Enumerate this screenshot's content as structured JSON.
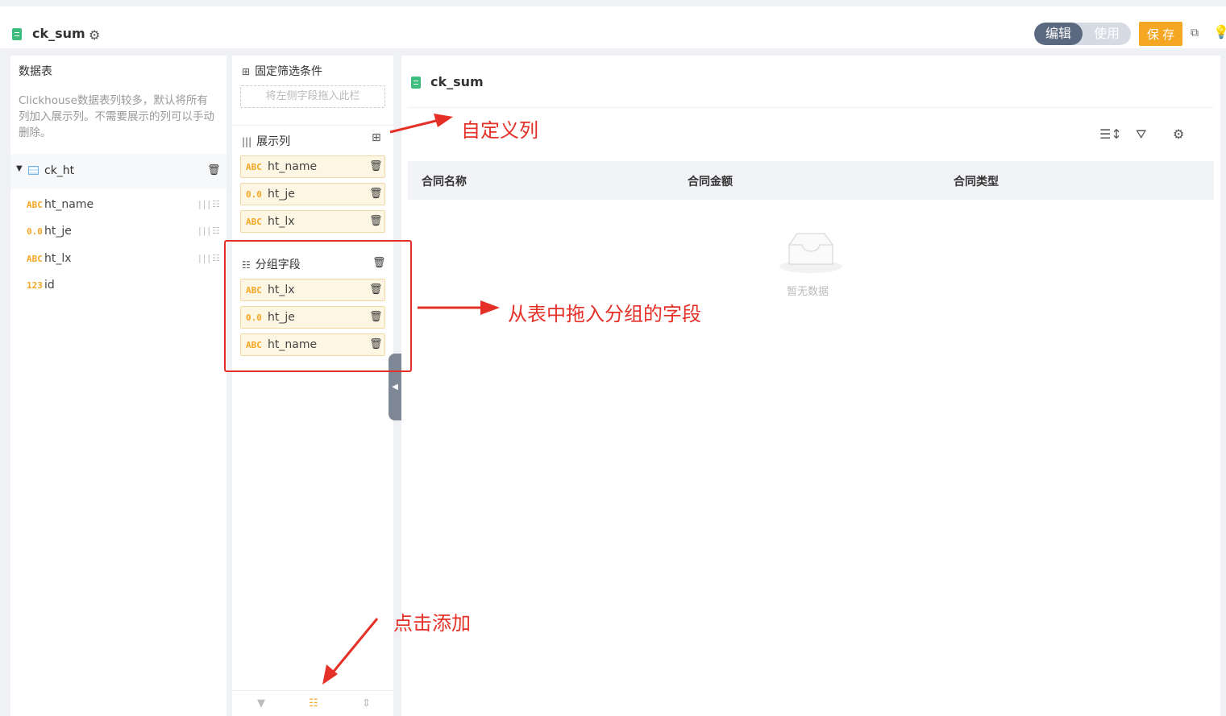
{
  "header": {
    "title": "ck_sum",
    "mode_edit": "编辑",
    "mode_use": "使用",
    "save_label": "保 存"
  },
  "left_panel": {
    "title": "数据表",
    "description": "Clickhouse数据表列较多，默认将所有列加入展示列。不需要展示的列可以手动删除。",
    "table_name": "ck_ht",
    "fields": [
      {
        "type": "ABC",
        "name": "ht_name"
      },
      {
        "type": "0.0",
        "name": "ht_je"
      },
      {
        "type": "ABC",
        "name": "ht_lx"
      },
      {
        "type": "123",
        "name": "id"
      }
    ]
  },
  "mid_panel": {
    "filter_title": "固定筛选条件",
    "filter_placeholder": "将左侧字段拖入此栏",
    "display_title": "展示列",
    "display_fields": [
      {
        "type": "ABC",
        "name": "ht_name"
      },
      {
        "type": "0.0",
        "name": "ht_je"
      },
      {
        "type": "ABC",
        "name": "ht_lx"
      }
    ],
    "group_title": "分组字段",
    "group_fields": [
      {
        "type": "ABC",
        "name": "ht_lx"
      },
      {
        "type": "0.0",
        "name": "ht_je"
      },
      {
        "type": "ABC",
        "name": "ht_name"
      }
    ]
  },
  "right_panel": {
    "title": "ck_sum",
    "columns": [
      "合同名称",
      "合同金额",
      "合同类型"
    ],
    "empty_text": "暂无数据"
  },
  "annotations": {
    "custom_column": "自定义列",
    "drag_group": "从表中拖入分组的字段",
    "click_add": "点击添加"
  },
  "colors": {
    "accent": "#f5a623",
    "annotation": "#e53027",
    "mode_active": "#5a6880"
  }
}
